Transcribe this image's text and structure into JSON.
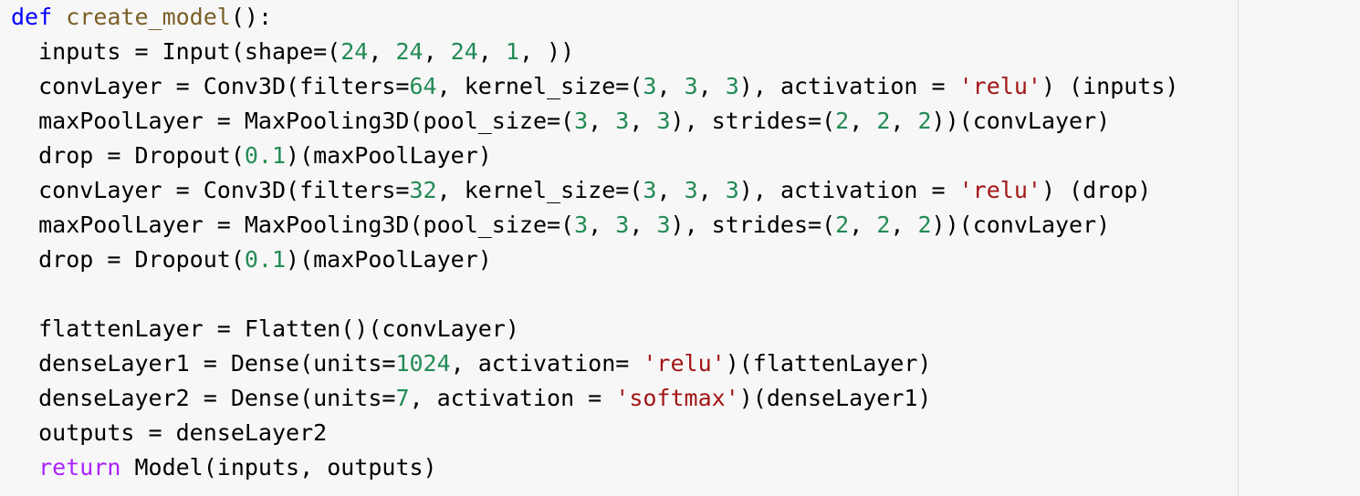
{
  "colors": {
    "background": "#f7f7f7",
    "text": "#000000",
    "keyword_def": "#0000ff",
    "keyword_return": "#aa22ff",
    "function_name": "#795e26",
    "number": "#228b55",
    "string": "#a31515",
    "ruler": "#d9d9d9"
  },
  "code": {
    "lines": [
      [
        [
          "kw-def",
          "def"
        ],
        [
          "p",
          " "
        ],
        [
          "fn",
          "create_model"
        ],
        [
          "p",
          "():"
        ]
      ],
      [
        [
          "p",
          "  inputs = Input(shape=("
        ],
        [
          "num",
          "24"
        ],
        [
          "p",
          ", "
        ],
        [
          "num",
          "24"
        ],
        [
          "p",
          ", "
        ],
        [
          "num",
          "24"
        ],
        [
          "p",
          ", "
        ],
        [
          "num",
          "1"
        ],
        [
          "p",
          ", ))"
        ]
      ],
      [
        [
          "p",
          "  convLayer = Conv3D(filters="
        ],
        [
          "num",
          "64"
        ],
        [
          "p",
          ", kernel_size=("
        ],
        [
          "num",
          "3"
        ],
        [
          "p",
          ", "
        ],
        [
          "num",
          "3"
        ],
        [
          "p",
          ", "
        ],
        [
          "num",
          "3"
        ],
        [
          "p",
          "), activation = "
        ],
        [
          "str",
          "'relu'"
        ],
        [
          "p",
          ") (inputs)"
        ]
      ],
      [
        [
          "p",
          "  maxPoolLayer = MaxPooling3D(pool_size=("
        ],
        [
          "num",
          "3"
        ],
        [
          "p",
          ", "
        ],
        [
          "num",
          "3"
        ],
        [
          "p",
          ", "
        ],
        [
          "num",
          "3"
        ],
        [
          "p",
          "), strides=("
        ],
        [
          "num",
          "2"
        ],
        [
          "p",
          ", "
        ],
        [
          "num",
          "2"
        ],
        [
          "p",
          ", "
        ],
        [
          "num",
          "2"
        ],
        [
          "p",
          "))(convLayer)"
        ]
      ],
      [
        [
          "p",
          "  drop = Dropout("
        ],
        [
          "num",
          "0.1"
        ],
        [
          "p",
          ")(maxPoolLayer)"
        ]
      ],
      [
        [
          "p",
          "  convLayer = Conv3D(filters="
        ],
        [
          "num",
          "32"
        ],
        [
          "p",
          ", kernel_size=("
        ],
        [
          "num",
          "3"
        ],
        [
          "p",
          ", "
        ],
        [
          "num",
          "3"
        ],
        [
          "p",
          ", "
        ],
        [
          "num",
          "3"
        ],
        [
          "p",
          "), activation = "
        ],
        [
          "str",
          "'relu'"
        ],
        [
          "p",
          ") (drop)"
        ]
      ],
      [
        [
          "p",
          "  maxPoolLayer = MaxPooling3D(pool_size=("
        ],
        [
          "num",
          "3"
        ],
        [
          "p",
          ", "
        ],
        [
          "num",
          "3"
        ],
        [
          "p",
          ", "
        ],
        [
          "num",
          "3"
        ],
        [
          "p",
          "), strides=("
        ],
        [
          "num",
          "2"
        ],
        [
          "p",
          ", "
        ],
        [
          "num",
          "2"
        ],
        [
          "p",
          ", "
        ],
        [
          "num",
          "2"
        ],
        [
          "p",
          "))(convLayer)"
        ]
      ],
      [
        [
          "p",
          "  drop = Dropout("
        ],
        [
          "num",
          "0.1"
        ],
        [
          "p",
          ")(maxPoolLayer)"
        ]
      ],
      [
        [
          "p",
          ""
        ]
      ],
      [
        [
          "p",
          "  flattenLayer = Flatten()(convLayer)"
        ]
      ],
      [
        [
          "p",
          "  denseLayer1 = Dense(units="
        ],
        [
          "num",
          "1024"
        ],
        [
          "p",
          ", activation= "
        ],
        [
          "str",
          "'relu'"
        ],
        [
          "p",
          ")(flattenLayer)"
        ]
      ],
      [
        [
          "p",
          "  denseLayer2 = Dense(units="
        ],
        [
          "num",
          "7"
        ],
        [
          "p",
          ", activation = "
        ],
        [
          "str",
          "'softmax'"
        ],
        [
          "p",
          ")(denseLayer1)"
        ]
      ],
      [
        [
          "p",
          "  outputs = denseLayer2"
        ]
      ],
      [
        [
          "p",
          "  "
        ],
        [
          "kw-ret",
          "return"
        ],
        [
          "p",
          " Model(inputs, outputs)"
        ]
      ]
    ]
  }
}
